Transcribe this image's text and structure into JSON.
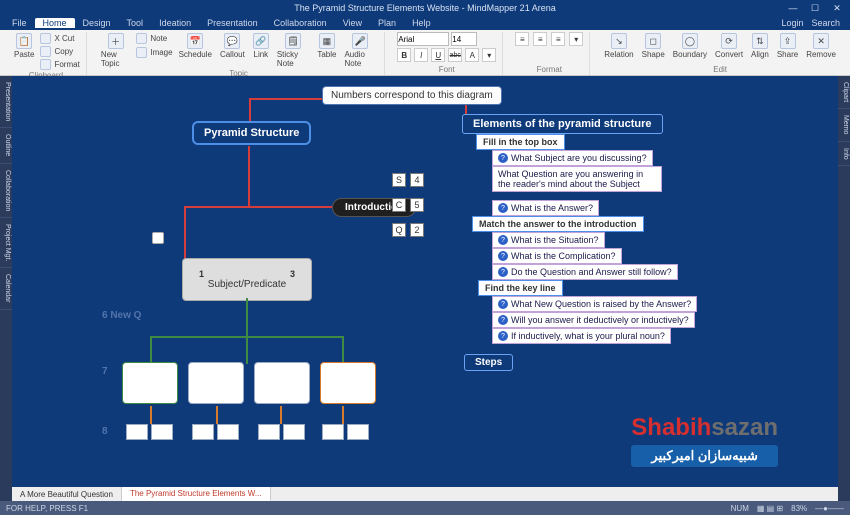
{
  "app": {
    "title": "The Pyramid Structure Elements Website - MindMapper 21 Arena",
    "login": "Login",
    "search": "Search"
  },
  "menu": {
    "items": [
      "File",
      "Home",
      "Design",
      "Tool",
      "Ideation",
      "Presentation",
      "Collaboration",
      "View",
      "Plan",
      "Help"
    ],
    "active": 1
  },
  "ribbon": {
    "clipboard": {
      "label": "Clipboard",
      "paste": "Paste",
      "cut": "X Cut",
      "copy": "Copy",
      "format": "Format"
    },
    "topic": {
      "label": "Topic",
      "new": "New Topic",
      "note": "Note",
      "image": "Image",
      "schedule": "Schedule",
      "callout": "Callout",
      "link": "Link",
      "sticky": "Sticky Note",
      "table": "Table",
      "audio": "Audio Note"
    },
    "font": {
      "label": "Font",
      "name": "Arial",
      "size": "14",
      "bold": "B",
      "italic": "I",
      "underline": "U",
      "strike": "abc"
    },
    "format": {
      "label": "Format"
    },
    "edit": {
      "label": "Edit",
      "relation": "Relation",
      "shape": "Shape",
      "boundary": "Boundary",
      "convert": "Convert",
      "align": "Align",
      "share": "Share",
      "remove": "Remove"
    }
  },
  "left_tabs": [
    "Presentation",
    "Outline",
    "Collaboration",
    "Project Mgt.",
    "Calendar"
  ],
  "right_tabs": [
    "Clipart",
    "Memo",
    "Info"
  ],
  "canvas": {
    "top_banner": "Numbers correspond to this diagram",
    "pyramid": "Pyramid  Structure",
    "intro": "Introduction",
    "keys": {
      "s": "S",
      "c": "C",
      "q": "Q",
      "k4": "4",
      "k5": "5",
      "k2": "2"
    },
    "subj": {
      "n1": "1",
      "n3": "3",
      "label": "Subject/Predicate"
    },
    "dim6": "6 New Q",
    "dim7": "7",
    "dim8": "8",
    "elements_head": "Elements  of  the  pyramid  structure",
    "sec1": "Fill in the top box",
    "i1": "What Subject are you discussing?",
    "i2": "What Question are you answering in the reader's mind about the Subject",
    "i3": "What is the Answer?",
    "sec2": "Match the answer to the introduction",
    "i4": "What is the Situation?",
    "i5": "What is the Complication?",
    "i6": "Do the Question and Answer still follow?",
    "sec3": "Find the key line",
    "i7": "What New Question is raised by the Answer?",
    "i8": "Will you answer it deductively or inductively?",
    "i9": "If inductively, what is your plural noun?",
    "steps": "Steps"
  },
  "footer_tabs": {
    "t1": "A More Beautiful Question",
    "t2": "The Pyramid Structure Elements W..."
  },
  "status": {
    "help": "FOR HELP, PRESS F1",
    "num": "NUM",
    "zoom": "83%"
  },
  "logo": {
    "word": "Shabihsazan",
    "sub": "شبیه‌سازان امیرکبیر"
  }
}
